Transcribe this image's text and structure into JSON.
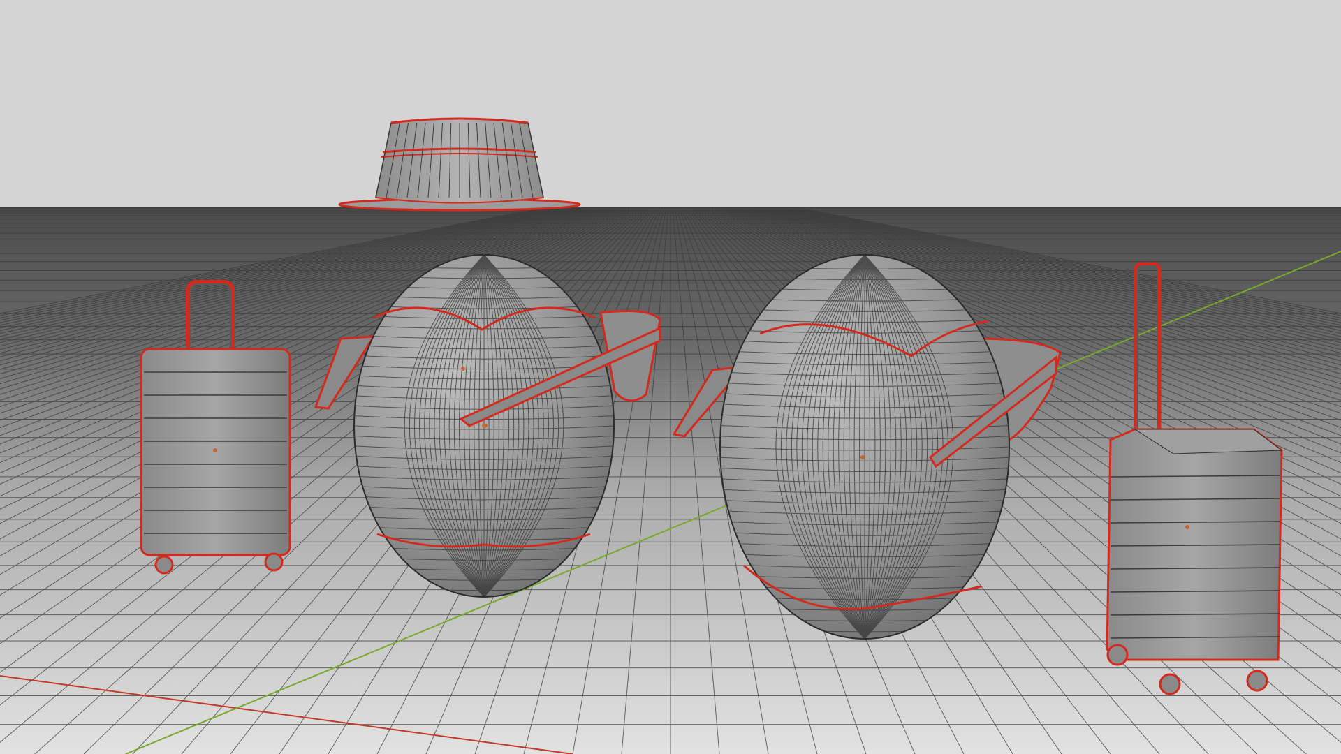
{
  "viewport": {
    "background_sky": "#d4d4d4",
    "ground_far": "#4a4a4a",
    "ground_near": "#dcdcdc",
    "grid_line_color": "#3a3a3a",
    "x_axis_color": "#c0392b",
    "y_axis_color": "#7aa82a",
    "mesh_fill": "#9a9a9a",
    "mesh_edge_color": "#2b2b2b",
    "selection_outline_color": "#d42a1e",
    "pivot_color": "#c0662e"
  },
  "objects": [
    {
      "name": "hat",
      "icon": "hat-mesh"
    },
    {
      "name": "egg-left",
      "icon": "egg-mesh"
    },
    {
      "name": "egg-right",
      "icon": "egg-mesh"
    },
    {
      "name": "sunglasses-left",
      "icon": "glasses-mesh"
    },
    {
      "name": "sunglasses-right",
      "icon": "glasses-mesh"
    },
    {
      "name": "suitcase-left",
      "icon": "suitcase-mesh"
    },
    {
      "name": "suitcase-right",
      "icon": "suitcase-mesh"
    }
  ]
}
